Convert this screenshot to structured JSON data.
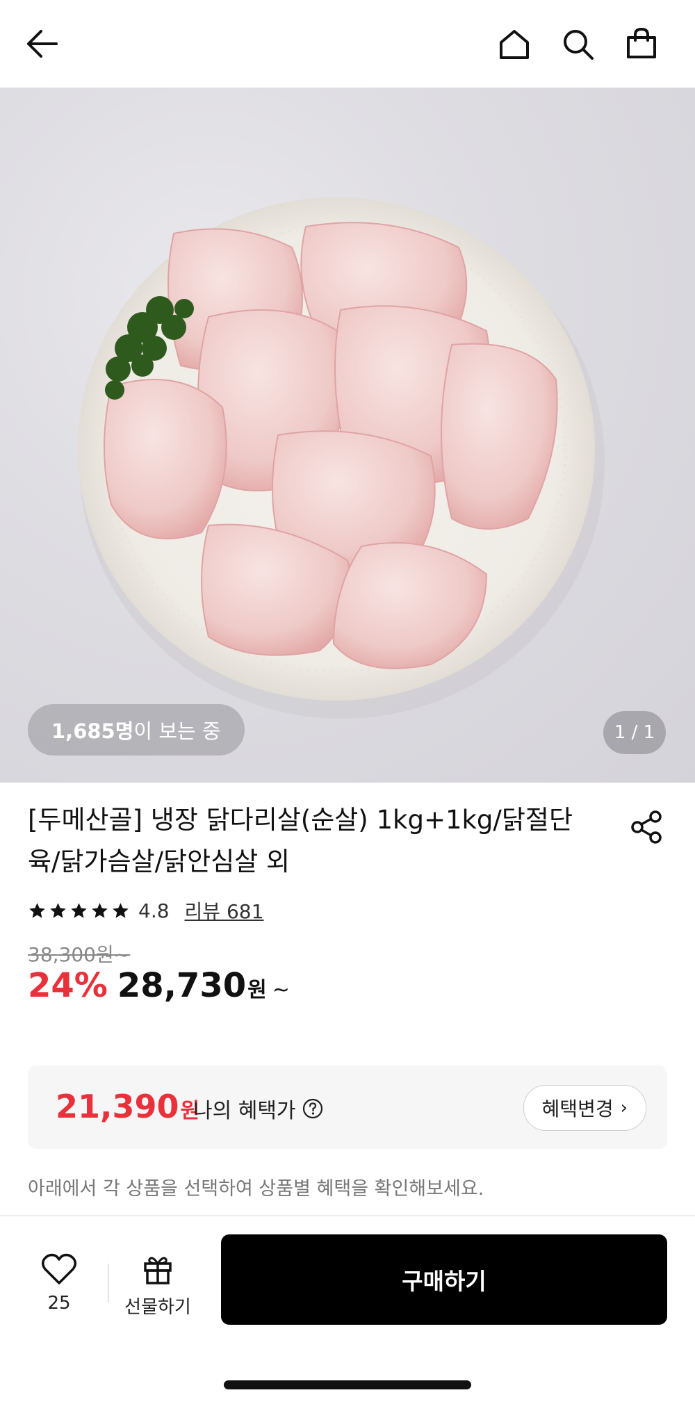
{
  "product": {
    "viewers_count": "1,685명",
    "viewers_suffix": "이 보는 중",
    "image_counter": "1 / 1",
    "title": "[두메산골] 냉장 닭다리살(순살) 1kg+1kg/닭절단육/닭가슴살/닭안심살 외",
    "rating": "4.8",
    "review_link": "리뷰 681",
    "original_price": "38,300원~",
    "discount": "24%",
    "sale_price": "28,730",
    "sale_unit": "원",
    "sale_tilde": "~"
  },
  "benefit": {
    "price": "21,390",
    "unit": "원",
    "label": "나의 혜택가",
    "change_button": "혜택변경",
    "hint": "아래에서 각 상품을 선택하여 상품별 혜택을 확인해보세요."
  },
  "bottom": {
    "like_count": "25",
    "gift_label": "선물하기",
    "buy_label": "구매하기"
  },
  "colors": {
    "accent_red": "#e8313a",
    "buy_button": "#000000"
  },
  "icons": [
    "back-arrow-icon",
    "home-icon",
    "search-icon",
    "shopping-bag-icon",
    "share-icon",
    "star-icon",
    "question-icon",
    "heart-icon",
    "gift-icon"
  ]
}
